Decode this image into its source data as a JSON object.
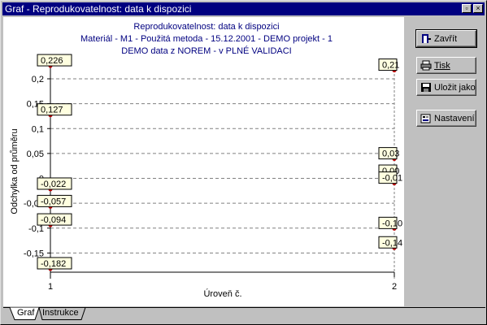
{
  "window": {
    "title": "Graf - Reprodukovatelnost: data k dispozici",
    "controls": [
      "minimize-maximize",
      "close"
    ]
  },
  "chart_header": {
    "line1": "Reprodukovatelnost: data k dispozici",
    "line2": "Materiál - M1 - Použitá metoda - 15.12.2001 - DEMO projekt - 1",
    "line3": "DEMO data z NOREM - v PLNÉ VALIDACI"
  },
  "chart_data": {
    "type": "scatter",
    "title": "Reprodukovatelnost: data k dispozici",
    "xlabel": "Úroveň č.",
    "ylabel": "Odchylka od průměru",
    "xlim": [
      1,
      2
    ],
    "ylim": [
      -0.2,
      0.25
    ],
    "x_ticks": [
      "1",
      "2"
    ],
    "y_ticks": [
      "0,2",
      "0,15",
      "0,1",
      "0,05",
      "0",
      "-0,05",
      "-0,1",
      "-0,15"
    ],
    "grid": true,
    "series": [
      {
        "x": 1,
        "values": [
          0.226,
          0.127,
          -0.022,
          -0.057,
          -0.094,
          -0.182
        ],
        "labels": [
          "0,226",
          "0,127",
          "-0,022",
          "-0,057",
          "-0,094",
          "-0,182"
        ]
      },
      {
        "x": 2,
        "values": [
          0.217,
          0.039,
          0.004,
          -0.01,
          -0.101,
          -0.14
        ],
        "labels": [
          "0,21",
          "0,03",
          "0,00",
          "-0,01",
          "-0,10",
          "-0,14"
        ]
      }
    ]
  },
  "buttons": {
    "close": "Zavřít",
    "print": "Tisk",
    "save_as": "Uložit jako",
    "settings": "Nastavení"
  },
  "tabs": [
    "Graf",
    "Instrukce"
  ]
}
